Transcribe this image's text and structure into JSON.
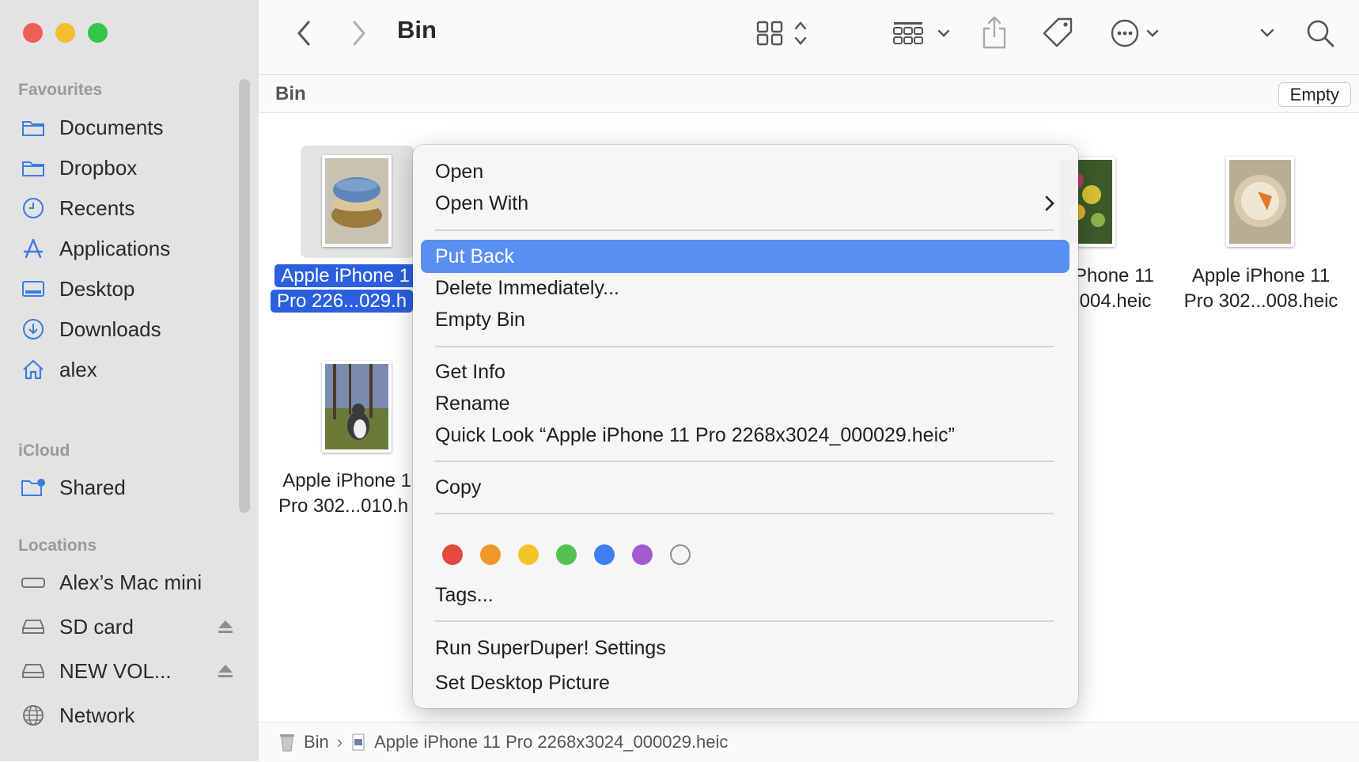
{
  "window": {
    "title": "Bin"
  },
  "sidebar": {
    "sections": [
      {
        "title": "Favourites",
        "items": [
          {
            "label": "Documents",
            "icon": "folder-icon"
          },
          {
            "label": "Dropbox",
            "icon": "folder-icon"
          },
          {
            "label": "Recents",
            "icon": "clock-icon"
          },
          {
            "label": "Applications",
            "icon": "applications-icon"
          },
          {
            "label": "Desktop",
            "icon": "desktop-icon"
          },
          {
            "label": "Downloads",
            "icon": "download-icon"
          },
          {
            "label": "alex",
            "icon": "home-icon"
          }
        ]
      },
      {
        "title": "iCloud",
        "items": [
          {
            "label": "Shared",
            "icon": "shared-folder-icon"
          }
        ]
      },
      {
        "title": "Locations",
        "items": [
          {
            "label": "Alex’s Mac mini",
            "icon": "computer-icon"
          },
          {
            "label": "SD card",
            "icon": "drive-icon"
          },
          {
            "label": "NEW VOL...",
            "icon": "drive-icon"
          },
          {
            "label": "Network",
            "icon": "globe-icon"
          }
        ]
      }
    ]
  },
  "pathbar": {
    "title": "Bin",
    "empty_label": "Empty"
  },
  "files": [
    {
      "line1": "Apple iPhone 1",
      "line2": "Pro 226...029.h",
      "selected": true
    },
    {
      "line1": "Phone 11",
      "line2": ".004.heic",
      "selected": false
    },
    {
      "line1": "Apple iPhone 11",
      "line2": "Pro 302...008.heic",
      "selected": false
    },
    {
      "line1": "Apple iPhone 1",
      "line2": "Pro 302...010.h",
      "selected": false
    }
  ],
  "context_menu": {
    "items": [
      {
        "label": "Open"
      },
      {
        "label": "Open With",
        "submenu": true
      },
      {
        "label": "Put Back",
        "highlighted": true
      },
      {
        "label": "Delete Immediately..."
      },
      {
        "label": "Empty Bin"
      },
      {
        "label": "Get Info"
      },
      {
        "label": "Rename"
      },
      {
        "label": "Quick Look “Apple iPhone 11 Pro 2268x3024_000029.heic”"
      },
      {
        "label": "Copy"
      },
      {
        "label": "Tags..."
      },
      {
        "label": "Run SuperDuper! Settings"
      },
      {
        "label": "Set Desktop Picture"
      }
    ],
    "tag_colors": [
      "#e5483d",
      "#f0962b",
      "#f2c62a",
      "#55c152",
      "#3e7ef0",
      "#a35bd0",
      "none"
    ]
  },
  "statusbar": {
    "folder": "Bin",
    "file": "Apple iPhone 11 Pro 2268x3024_000029.heic"
  }
}
